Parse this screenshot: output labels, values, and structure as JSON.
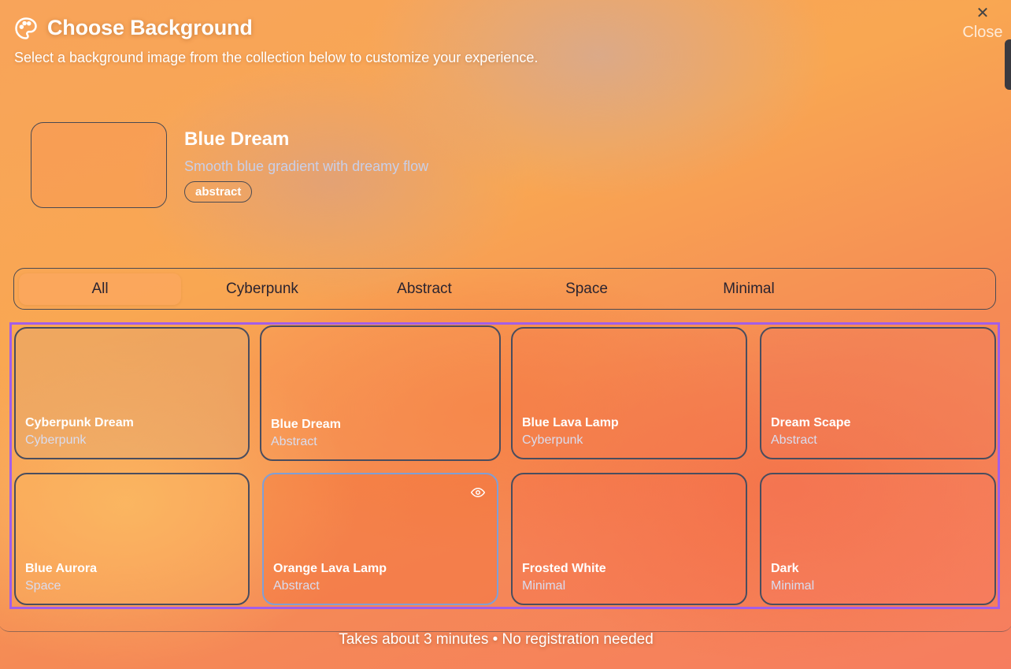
{
  "header": {
    "title": "Choose Background",
    "subtitle": "Select a background image from the collection below to customize your experience.",
    "icon": "palette-icon"
  },
  "close": {
    "icon": "close-icon",
    "label": "Close"
  },
  "preview": {
    "name": "Blue Dream",
    "description": "Smooth blue gradient with dreamy flow",
    "tag": "abstract"
  },
  "filters": [
    {
      "label": "All",
      "active": true
    },
    {
      "label": "Cyberpunk",
      "active": false
    },
    {
      "label": "Abstract",
      "active": false
    },
    {
      "label": "Space",
      "active": false
    },
    {
      "label": "Minimal",
      "active": false
    }
  ],
  "backgrounds": [
    {
      "name": "Cyberpunk Dream",
      "category": "Cyberpunk"
    },
    {
      "name": "Blue Dream",
      "category": "Abstract"
    },
    {
      "name": "Blue Lava Lamp",
      "category": "Cyberpunk"
    },
    {
      "name": "Dream Scape",
      "category": "Abstract"
    },
    {
      "name": "Blue Aurora",
      "category": "Space"
    },
    {
      "name": "Orange Lava Lamp",
      "category": "Abstract",
      "selected": true,
      "icon": "eye-icon"
    },
    {
      "name": "Frosted White",
      "category": "Minimal"
    },
    {
      "name": "Dark",
      "category": "Minimal"
    }
  ],
  "footer": "Takes about 3 minutes • No registration needed",
  "colors": {
    "grid_outline": "#a35ee8",
    "card_border": "#4a4d5e",
    "selected_border": "#7f9fd6",
    "category_text": "#d9dcef"
  }
}
